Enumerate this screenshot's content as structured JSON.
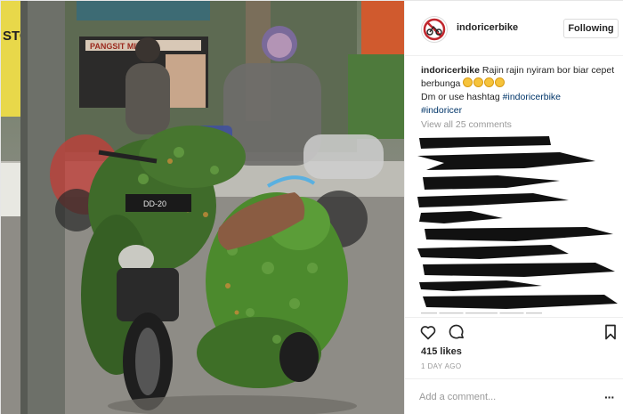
{
  "header": {
    "username": "indoricerbike",
    "follow_label": "Following",
    "avatar_icon": "no-bike-logo-icon"
  },
  "caption": {
    "username": "indoricerbike",
    "text": "Rajin rajin nyiram bor biar cepet berbunga",
    "emoji_icon": "grinning-sweat-emoji-icon",
    "emoji_count": 4,
    "line2_prefix": "Dm or use hashtag ",
    "hashtags": [
      "#indoricerbike",
      "#indoricer"
    ]
  },
  "view_all_comments": "View all 25 comments",
  "comments_redacted": true,
  "actions": {
    "icons": [
      "heart-icon",
      "comment-icon",
      "bookmark-icon"
    ]
  },
  "likes": "415 likes",
  "timestamp": "1 DAY AGO",
  "comment_box": {
    "placeholder": "Add a comment...",
    "more_icon": "more-options-icon"
  },
  "photo": {
    "subject": "motorcycle-covered-in-plants",
    "plate_text": "DD-20",
    "shop_sign_text": "PANGSIT MIE"
  },
  "colors": {
    "link": "#003569",
    "muted": "#999999",
    "text": "#262626",
    "border": "#efefef"
  }
}
